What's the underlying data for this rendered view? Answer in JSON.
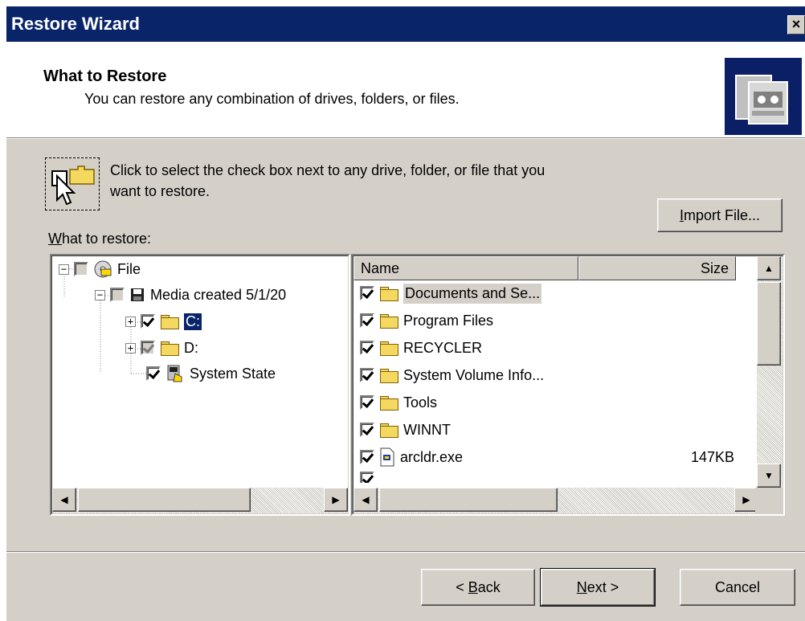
{
  "window": {
    "title": "Restore Wizard",
    "close_label": "×"
  },
  "header": {
    "title": "What to Restore",
    "subtitle": "You can restore any combination of drives, folders, or files."
  },
  "hint": {
    "line1": "Click to select the check box next to any drive, folder, or file that you",
    "line2": "want to restore."
  },
  "import_button": {
    "label_prefix": "I",
    "label_rest": "mport File..."
  },
  "restore_label": {
    "prefix": "W",
    "rest": "hat to restore:"
  },
  "tree": {
    "items": [
      {
        "label": "File",
        "expander": "−",
        "checked": false,
        "icon": "file-media-icon"
      },
      {
        "label": "Media created 5/1/20",
        "expander": "−",
        "checked": false,
        "icon": "disk-icon"
      },
      {
        "label": "C:",
        "expander": "+",
        "checked": true,
        "icon": "folder-icon",
        "selected": true
      },
      {
        "label": "D:",
        "expander": "+",
        "checked": true,
        "icon": "folder-icon",
        "grayed": true
      },
      {
        "label": "System State",
        "expander": "",
        "checked": true,
        "icon": "system-state-icon"
      }
    ]
  },
  "list": {
    "columns": {
      "name": "Name",
      "size": "Size"
    },
    "rows": [
      {
        "name": "Documents and Se...",
        "size": "",
        "checked": true,
        "icon": "folder-icon",
        "selected": true
      },
      {
        "name": "Program Files",
        "size": "",
        "checked": true,
        "icon": "folder-icon"
      },
      {
        "name": "RECYCLER",
        "size": "",
        "checked": true,
        "icon": "folder-icon"
      },
      {
        "name": "System Volume Info...",
        "size": "",
        "checked": true,
        "icon": "folder-icon"
      },
      {
        "name": "Tools",
        "size": "",
        "checked": true,
        "icon": "folder-icon"
      },
      {
        "name": "WINNT",
        "size": "",
        "checked": true,
        "icon": "folder-icon"
      },
      {
        "name": "arcldr.exe",
        "size": "147KB",
        "checked": true,
        "icon": "exe-file-icon"
      }
    ]
  },
  "buttons": {
    "back": {
      "prefix": "< ",
      "underline": "B",
      "rest": "ack"
    },
    "next": {
      "underline": "N",
      "rest": "ext >"
    },
    "cancel": {
      "label": "Cancel"
    }
  },
  "colors": {
    "titlebar": "#0a246a",
    "dialog_face": "#d4d0c8",
    "checkmark": "#000000"
  }
}
